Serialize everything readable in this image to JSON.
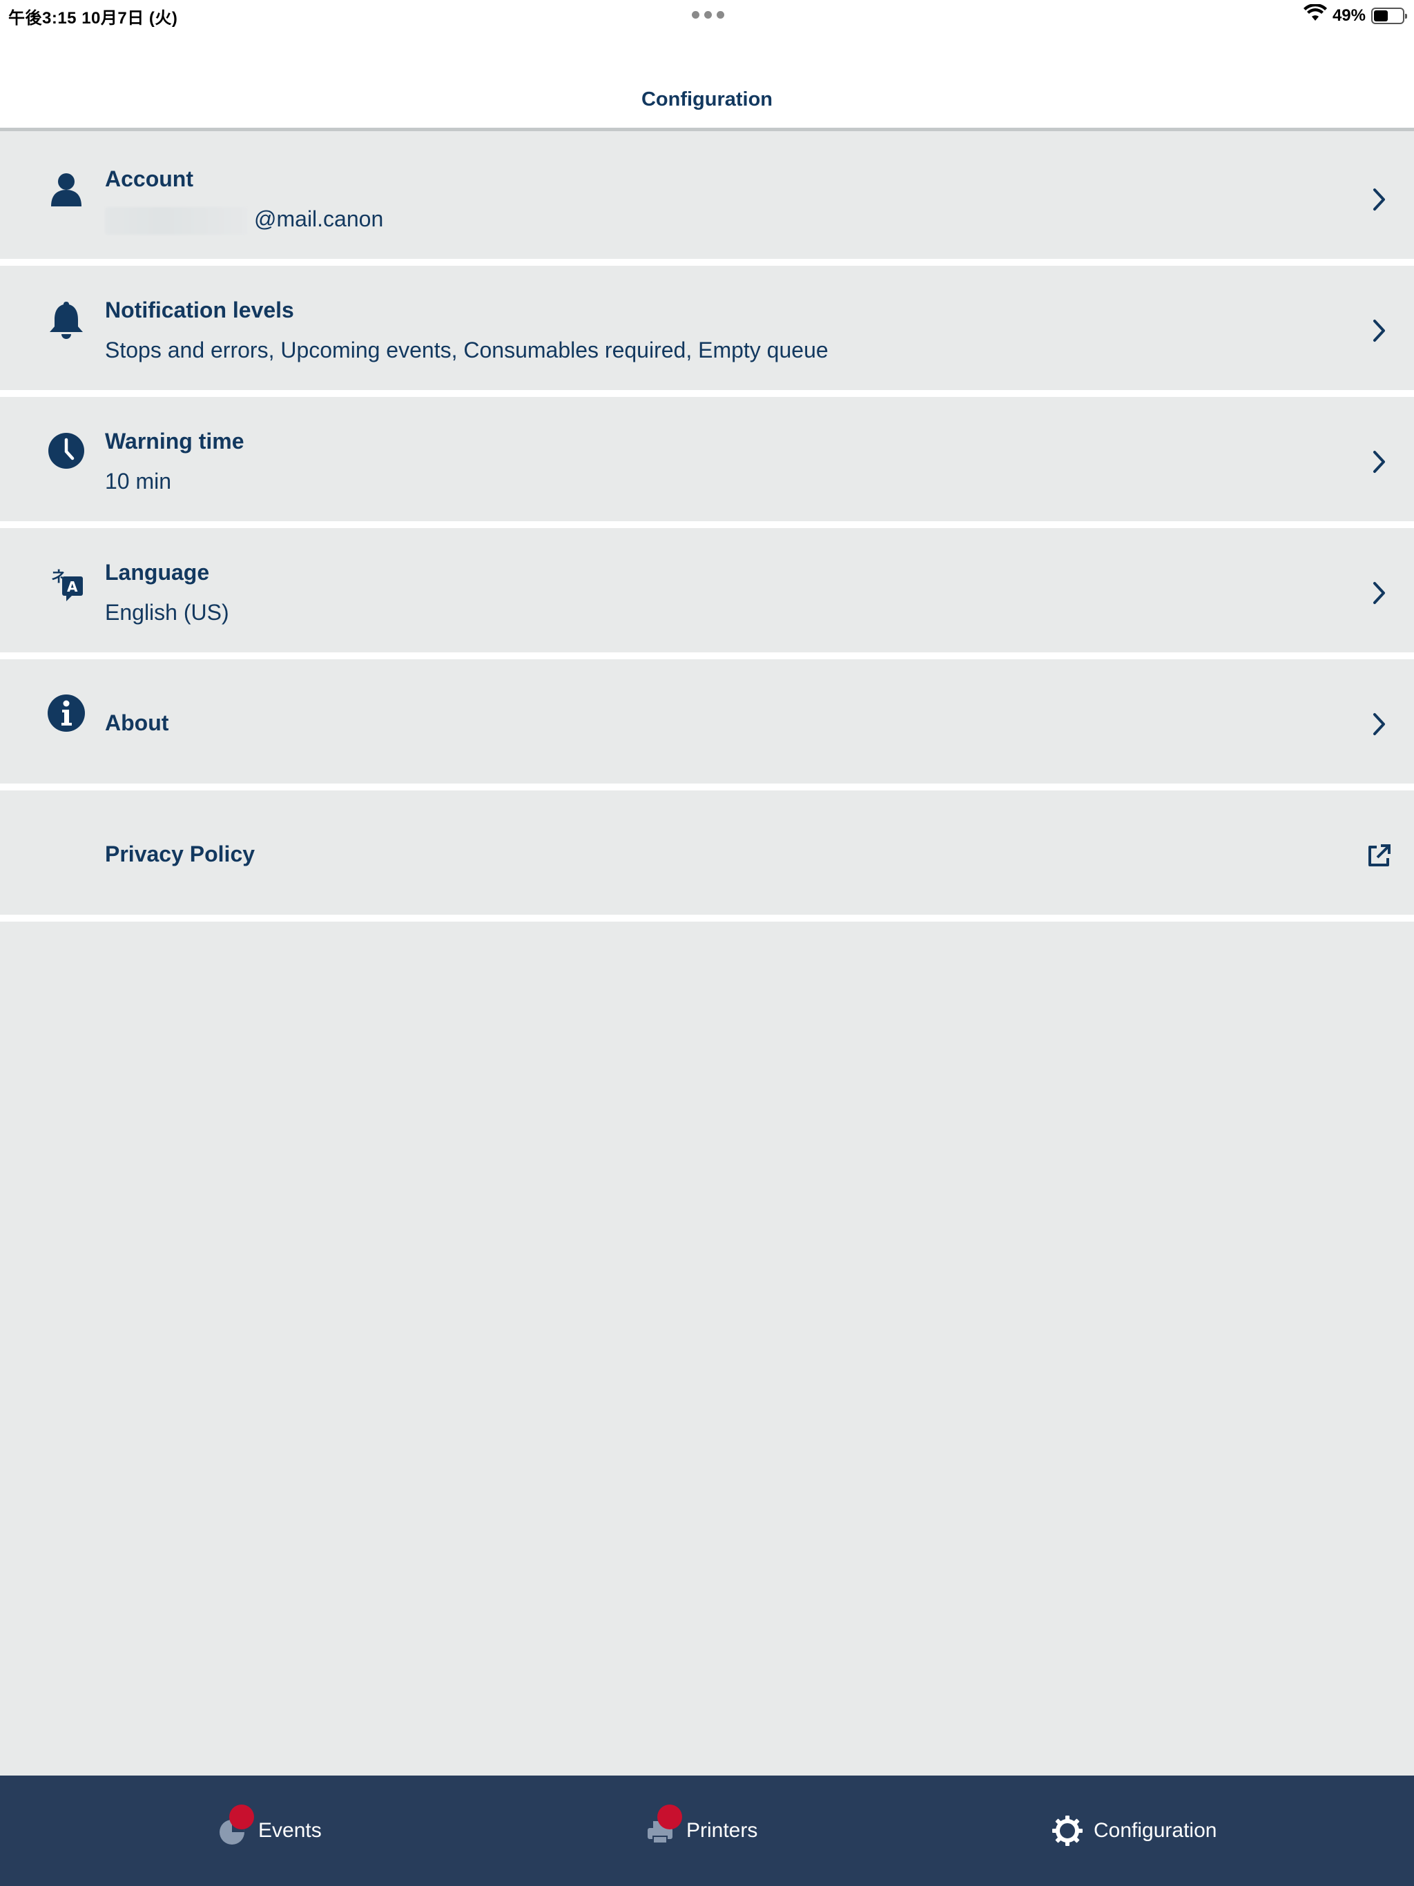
{
  "status_bar": {
    "time_date": "午後3:15   10月7日 (火)",
    "battery_percent": "49%",
    "battery_level": 0.49
  },
  "header": {
    "title": "Configuration"
  },
  "settings": {
    "account": {
      "title": "Account",
      "subtitle": "@mail.canon",
      "icon": "person-icon"
    },
    "notifications": {
      "title": "Notification levels",
      "subtitle": "Stops and errors, Upcoming events, Consumables required, Empty queue",
      "icon": "bell-icon"
    },
    "warning_time": {
      "title": "Warning time",
      "subtitle": "10 min",
      "icon": "clock-icon"
    },
    "language": {
      "title": "Language",
      "subtitle": "English (US)",
      "icon": "translate-icon"
    },
    "about": {
      "title": "About",
      "icon": "info-icon"
    },
    "privacy": {
      "title": "Privacy Policy",
      "icon": "external-link-icon"
    }
  },
  "tabs": {
    "events": {
      "label": "Events",
      "icon": "events-icon",
      "badge": true
    },
    "printers": {
      "label": "Printers",
      "icon": "printer-icon",
      "badge": true
    },
    "configuration": {
      "label": "Configuration",
      "icon": "gear-icon",
      "active": true
    }
  },
  "colors": {
    "primary": "#12385f",
    "background": "#e8eaea",
    "tabbar": "#283d5b",
    "badge": "#c8102e"
  }
}
